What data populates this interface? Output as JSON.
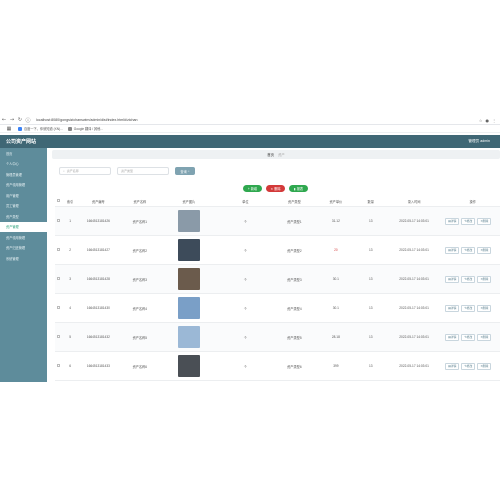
{
  "browser": {
    "url": "localhost:8080/gongsizichanswim/admin/dist/index.html#/zichan",
    "bookmarks": [
      {
        "label": "百度一下，你就知道 (XN)..."
      },
      {
        "label": "Google 翻译 / 其他..."
      }
    ]
  },
  "header": {
    "title": "公司资产网站",
    "user": "管理员 admin"
  },
  "sidebar": {
    "items": [
      {
        "label": "首页"
      },
      {
        "label": "个人中心"
      },
      {
        "label": "管理员管理"
      },
      {
        "label": "资产领用管理"
      },
      {
        "label": "用户管理"
      },
      {
        "label": "员工管理"
      },
      {
        "label": "资产类型"
      },
      {
        "label": "资产管理"
      },
      {
        "label": "资产领用管理"
      },
      {
        "label": "资产归还管理"
      },
      {
        "label": "系统管理"
      }
    ]
  },
  "tabs": [
    {
      "label": "首页"
    },
    {
      "label": "资产"
    }
  ],
  "search": {
    "name_placeholder": "资产名称",
    "type_placeholder": "资产类型",
    "button": "查询"
  },
  "actions": {
    "add": "新增",
    "delete": "删除",
    "stats": "报表"
  },
  "table": {
    "headers": [
      "索引",
      "资产编号",
      "资产名称",
      "资产图片",
      "单位",
      "资产类型",
      "资产单价",
      "数量",
      "录入时间",
      "操作"
    ],
    "ops": [
      "详情",
      "修改",
      "删除"
    ],
    "rows": [
      {
        "idx": "1",
        "code": "1664513181426",
        "name": "资产名称1",
        "unit": "个",
        "type": "资产类型1",
        "price": "31.12",
        "qty": "13",
        "time": "2022-05-17 14:03:01",
        "price_red": false,
        "thumb": "#8a9aa8"
      },
      {
        "idx": "2",
        "code": "1664513181427",
        "name": "资产名称2",
        "unit": "个",
        "type": "资产类型2",
        "price": "20",
        "qty": "13",
        "time": "2022-05-17 14:03:01",
        "price_red": true,
        "thumb": "#3d4b5a"
      },
      {
        "idx": "3",
        "code": "1664513181428",
        "name": "资产名称3",
        "unit": "个",
        "type": "资产类型3",
        "price": "30.1",
        "qty": "13",
        "time": "2022-05-17 14:03:01",
        "price_red": false,
        "thumb": "#6b5b4c"
      },
      {
        "idx": "4",
        "code": "1664513181430",
        "name": "资产名称4",
        "unit": "个",
        "type": "资产类型4",
        "price": "30.1",
        "qty": "13",
        "time": "2022-05-17 14:03:01",
        "price_red": false,
        "thumb": "#7a9fc7"
      },
      {
        "idx": "5",
        "code": "1664513181432",
        "name": "资产名称5",
        "unit": "个",
        "type": "资产类型5",
        "price": "28.18",
        "qty": "13",
        "time": "2022-05-17 14:03:01",
        "price_red": false,
        "thumb": "#9bb8d6"
      },
      {
        "idx": "6",
        "code": "1664513181433",
        "name": "资产名称6",
        "unit": "个",
        "type": "资产类型6",
        "price": "399",
        "qty": "13",
        "time": "2022-05-17 14:03:01",
        "price_red": false,
        "thumb": "#4a4f55"
      }
    ]
  }
}
